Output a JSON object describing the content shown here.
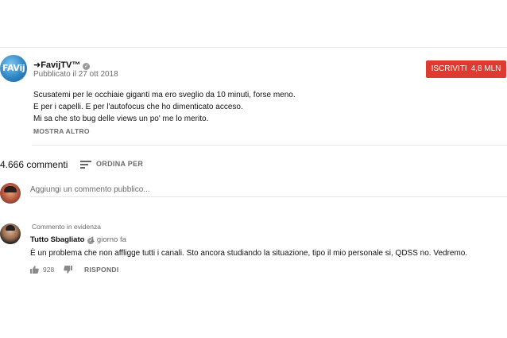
{
  "video": {
    "channel_name": "➜FavijTV™",
    "verified_mark": "✓",
    "avatar_text": "FAVij",
    "published": "Pubblicato il 27 ott 2018",
    "subscribe_label": "ISCRIVITI",
    "subscriber_count": "4,8 MLN",
    "description": [
      "Scusatemi per le occhiaie giganti ma ero sveglio da 10 minuti, forse meno.",
      "E per i capelli. E per l'autofocus che ho dimenticato acceso.",
      "Mi sa che sto bug delle views un po' me lo merito."
    ],
    "show_more_label": "MOSTRA ALTRO"
  },
  "comments_header": {
    "count_label": "4.666 commenti",
    "sort_label": "ORDINA PER"
  },
  "add_comment": {
    "placeholder": "Aggiungi un commento pubblico..."
  },
  "pinned_comment": {
    "pinned_label": "Commento in evidenza",
    "author": "Tutto Sbagliato",
    "verified_mark": "✓",
    "time": "1 giorno fa",
    "text": "È un problema che non affligge tutti i canali. Sto ancora studiando la situazione, tipo il mio personale si, QDSS no. Vedremo.",
    "likes": "928",
    "reply_label": "RISPONDI"
  },
  "colors": {
    "subscribe_bg": "#dd3b31",
    "secondary_text": "#6b6b6b",
    "divider": "#e6e6e6"
  },
  "icons": [
    "channel-avatar",
    "verified-icon",
    "sort-icon",
    "user-avatar",
    "commenter-avatar",
    "thumbs-up-icon",
    "thumbs-down-icon"
  ]
}
